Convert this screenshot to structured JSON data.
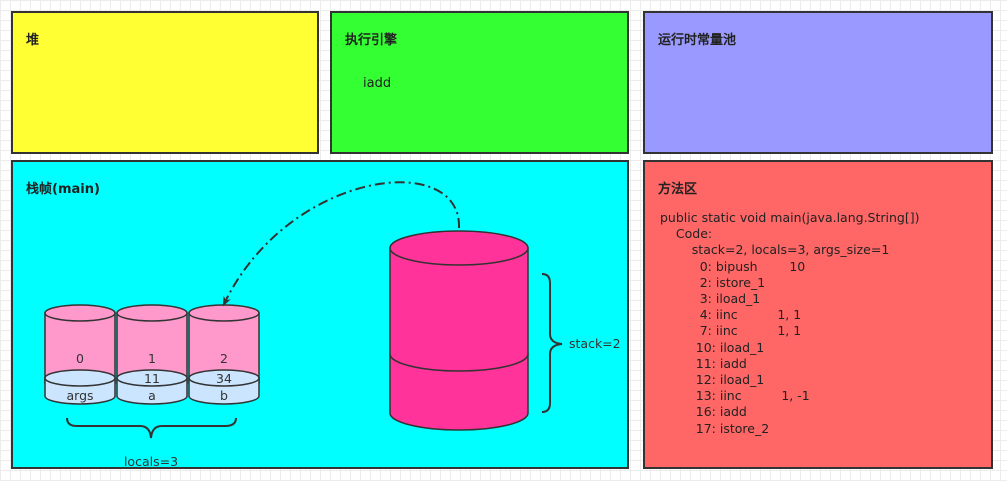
{
  "colors": {
    "heap": "#ffff33",
    "engine": "#33ff33",
    "pool": "#9999ff",
    "frame": "#00ffff",
    "method": "#ff6666",
    "locals_top": "#ff99cc",
    "locals_bottom": "#cce5ff",
    "operand_stack": "#ff3399"
  },
  "heap": {
    "title": "堆"
  },
  "engine": {
    "title": "执行引擎",
    "instruction": "iadd"
  },
  "pool": {
    "title": "运行时常量池"
  },
  "frame": {
    "title": "栈帧(main)",
    "locals": [
      {
        "index": "0",
        "value": "",
        "name": "args"
      },
      {
        "index": "1",
        "value": "11",
        "name": "a"
      },
      {
        "index": "2",
        "value": "34",
        "name": "b"
      }
    ],
    "locals_label": "locals=3",
    "stack_label": "stack=2"
  },
  "method_area": {
    "title": "方法区",
    "code": "public static void main(java.lang.String[])\n    Code:\n        stack=2, locals=3, args_size=1\n          0: bipush        10\n          2: istore_1\n          3: iload_1\n          4: iinc          1, 1\n          7: iinc          1, 1\n         10: iload_1\n         11: iadd\n         12: iload_1\n         13: iinc          1, -1\n         16: iadd\n         17: istore_2"
  }
}
